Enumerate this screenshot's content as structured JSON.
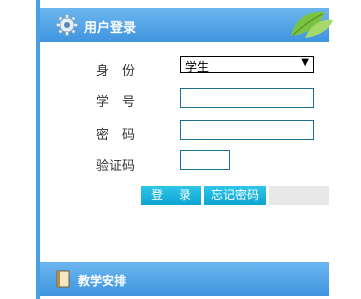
{
  "login_panel": {
    "title": "用户登录",
    "icon": "gear-icon",
    "decoration": "leaf-icon",
    "identity": {
      "label": "身　份",
      "selected": "学生"
    },
    "student_id": {
      "label": "学　号",
      "value": ""
    },
    "password": {
      "label": "密　码",
      "value": ""
    },
    "captcha": {
      "label": "验证码",
      "value": ""
    },
    "login_button": "登 录",
    "forgot_button": "忘记密码"
  },
  "schedule_panel": {
    "title": "教学安排",
    "icon": "book-icon"
  },
  "colors": {
    "header_blue": "#3f95df",
    "button_cyan": "#0ea4d2"
  }
}
